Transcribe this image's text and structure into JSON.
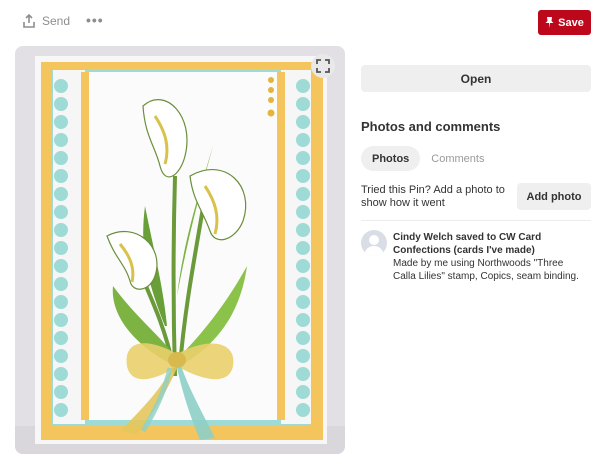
{
  "toolbar": {
    "send_label": "Send",
    "more_icon": "more-horizontal-icon",
    "save_label": "Save",
    "save_color": "#bd081c"
  },
  "pin": {
    "image_description_icon": "expand-icon"
  },
  "sidebar": {
    "open_label": "Open",
    "section_title": "Photos and comments",
    "tabs": [
      {
        "label": "Photos",
        "active": true
      },
      {
        "label": "Comments",
        "active": false
      }
    ],
    "tried_text": "Tried this Pin? Add a photo to show how it went",
    "add_photo_label": "Add photo",
    "saved_by": "Cindy Welch saved to CW Card Confections (cards I've made)",
    "description": "Made by me using Northwoods \"Three Calla Lilies\" stamp, Copics, seam binding."
  }
}
